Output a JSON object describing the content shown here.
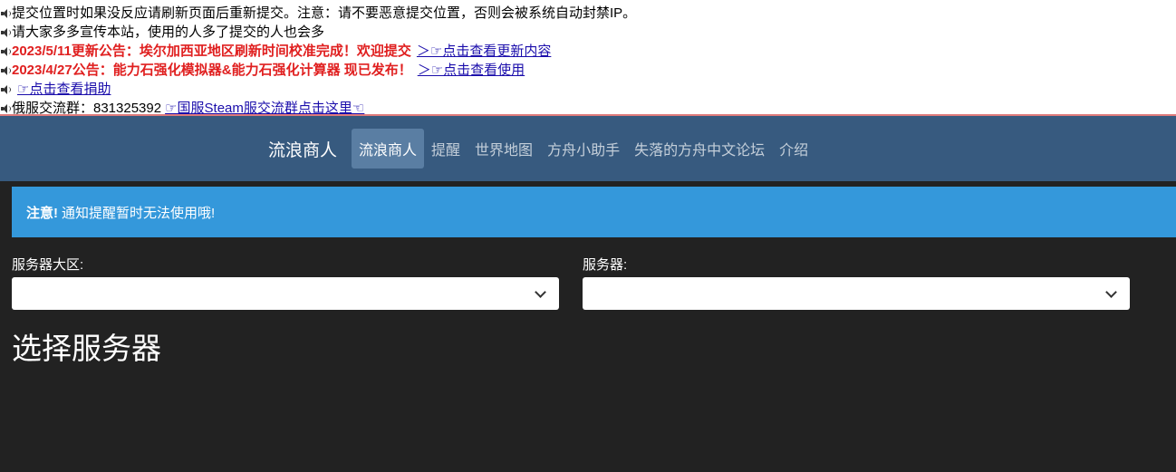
{
  "notices": {
    "line1": "提交位置时如果没反应请刷新页面后重新提交。注意：请不要恶意提交位置，否则会被系统自动封禁IP。",
    "line2": "请大家多多宣传本站，使用的人多了提交的人也会多",
    "line3_text": "2023/5/11更新公告：埃尔加西亚地区刷新时间校准完成！欢迎提交",
    "line3_link": "＞☞点击查看更新内容",
    "line4_text": "2023/4/27公告：能力石强化模拟器&能力石强化计算器 现已发布！",
    "line4_link": "＞☞点击查看使用",
    "line5_link": "☞点击查看捐助",
    "line6_text": "俄服交流群：831325392",
    "line6_link": "☞国服Steam服交流群点击这里☜"
  },
  "navbar": {
    "brand": "流浪商人",
    "items": [
      "流浪商人",
      "提醒",
      "世界地图",
      "方舟小助手",
      "失落的方舟中文论坛",
      "介绍"
    ]
  },
  "alert": {
    "strong": "注意!",
    "text": "通知提醒暂时无法使用哦!"
  },
  "form": {
    "region_label": "服务器大区:",
    "region_value": "",
    "server_label": "服务器:",
    "server_value": ""
  },
  "page_title": "选择服务器",
  "colors": {
    "navbar": "#375a7f",
    "alert": "#3498db",
    "background": "#222222",
    "notice_red": "#e02020"
  }
}
